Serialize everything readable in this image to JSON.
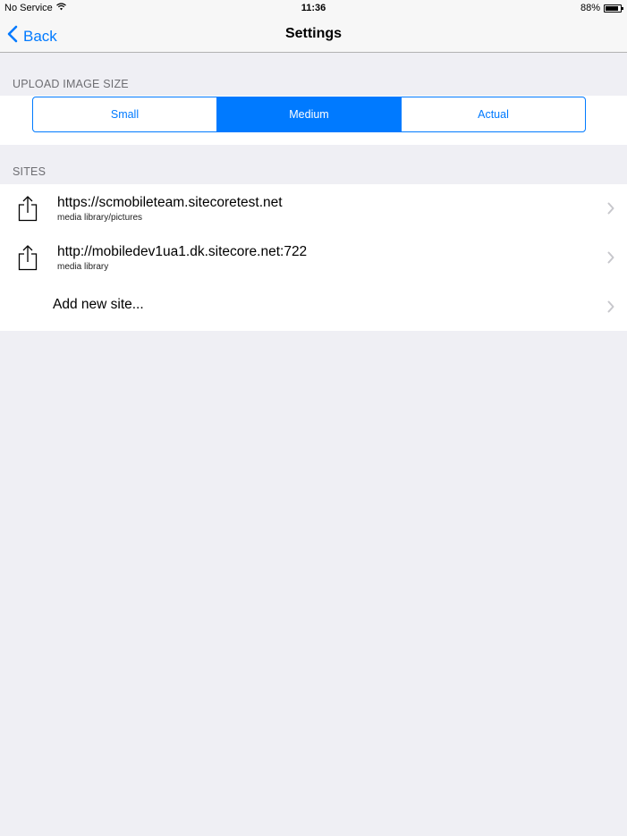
{
  "status": {
    "carrier": "No Service",
    "time": "11:36",
    "battery_text": "88%",
    "battery_level": 0.88
  },
  "nav": {
    "back_label": "Back",
    "title": "Settings"
  },
  "upload": {
    "header": "UPLOAD IMAGE SIZE",
    "options": [
      {
        "label": "Small",
        "selected": false
      },
      {
        "label": "Medium",
        "selected": true
      },
      {
        "label": "Actual",
        "selected": false
      }
    ]
  },
  "sites": {
    "header": "SITES",
    "items": [
      {
        "url": "https://scmobileteam.sitecoretest.net",
        "path": "media library/pictures"
      },
      {
        "url": "http://mobiledev1ua1.dk.sitecore.net:722",
        "path": "media library"
      }
    ],
    "add_label": "Add new site..."
  },
  "colors": {
    "accent": "#007aff",
    "background": "#efeff4",
    "section_text": "#6d6d72"
  },
  "icons": [
    "wifi-icon",
    "battery-icon",
    "back-chevron-icon",
    "share-icon",
    "chevron-right-icon"
  ]
}
